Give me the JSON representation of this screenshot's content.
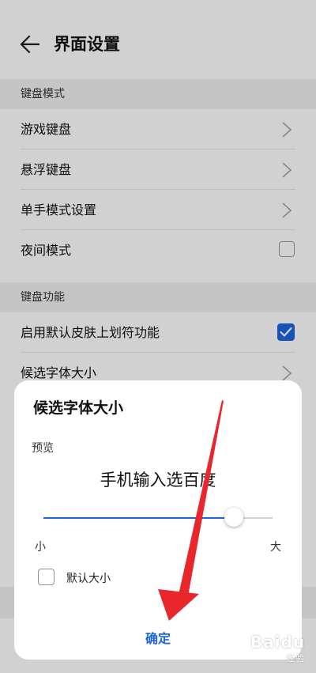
{
  "header": {
    "title": "界面设置",
    "back_icon": "arrow-left-icon"
  },
  "sections": [
    {
      "title": "键盘模式",
      "rows": [
        {
          "label": "游戏键盘",
          "control": "chevron"
        },
        {
          "label": "悬浮键盘",
          "control": "chevron"
        },
        {
          "label": "单手模式设置",
          "control": "chevron"
        },
        {
          "label": "夜间模式",
          "control": "checkbox",
          "checked": false
        }
      ]
    },
    {
      "title": "键盘功能",
      "rows": [
        {
          "label": "启用默认皮肤上划符功能",
          "control": "checkbox",
          "checked": true
        },
        {
          "label": "候选字体大小",
          "control": "chevron"
        }
      ]
    }
  ],
  "dialog": {
    "title": "候选字体大小",
    "preview_label": "预览",
    "preview_text": "手机输入选百度",
    "slider": {
      "value": 0.83,
      "min_label": "小",
      "max_label": "大"
    },
    "default_checkbox": {
      "label": "默认大小",
      "checked": false
    },
    "confirm_label": "确定"
  },
  "colors": {
    "accent": "#1a66e0",
    "annotation_arrow": "#e8262b",
    "overlay": "rgba(0,0,0,0.18)"
  },
  "watermark": {
    "text": "Baidu",
    "sub": "经验"
  }
}
